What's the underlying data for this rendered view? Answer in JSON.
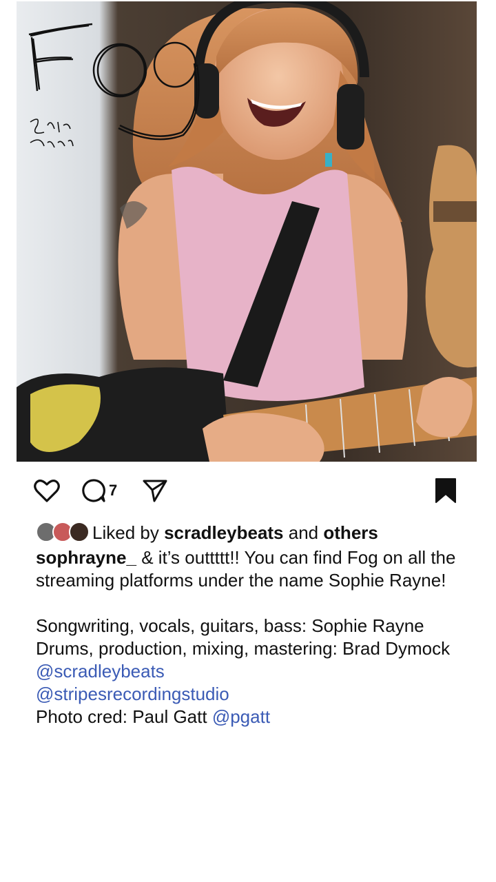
{
  "post": {
    "cover": {
      "title_art": "Fog",
      "artist_art": "Sophie Rayne"
    }
  },
  "actions": {
    "comment_count": "7"
  },
  "likes": {
    "prefix": "Liked by",
    "user": "scradleybeats",
    "and": "and",
    "others": "others"
  },
  "caption": {
    "username": "sophrayne_",
    "line1": "& it’s outtttt!! You can find Fog on all the streaming platforms under the name Sophie Rayne!",
    "credit1": "Songwriting, vocals, guitars, bass: Sophie Rayne",
    "credit2": "Drums, production, mixing, mastering: Brad Dymock",
    "mention_scradley": "@scradleybeats",
    "mention_studio": "@stripesrecordingstudio",
    "photo_prefix": "Photo cred: Paul Gatt",
    "mention_photo": "@pgatt"
  },
  "colors": {
    "mention": "#3b5bb5",
    "text": "#111111"
  }
}
